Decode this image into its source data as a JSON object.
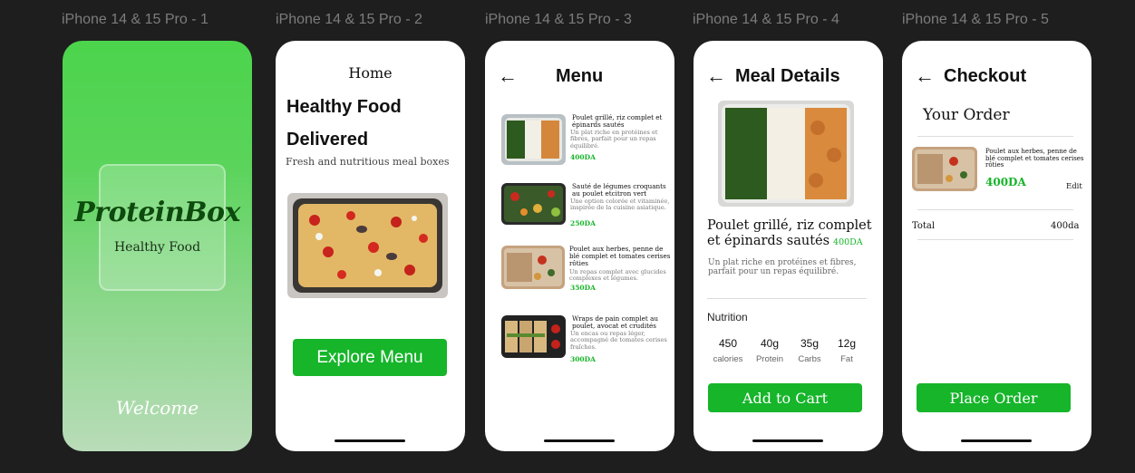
{
  "frames": [
    {
      "label": "iPhone 14 & 15 Pro - 1"
    },
    {
      "label": "iPhone 14 & 15 Pro - 2"
    },
    {
      "label": "iPhone 14 & 15 Pro - 3"
    },
    {
      "label": "iPhone 14 & 15 Pro - 4"
    },
    {
      "label": "iPhone 14 & 15 Pro - 5"
    }
  ],
  "splash": {
    "brand": "ProteinBox",
    "tagline": "Healthy Food",
    "welcome": "Welcome"
  },
  "home": {
    "title": "Home",
    "headline_1": "Healthy Food",
    "headline_2": "Delivered",
    "subtitle": "Fresh and nutritious meal boxes",
    "cta": "Explore Menu"
  },
  "menu": {
    "title": "Menu",
    "items": [
      {
        "name": "Poulet grillé, riz complet et épinards sautés",
        "desc": "Un plat riche en protéines et fibres, parfait pour un repas équilibré.",
        "price": "400DA"
      },
      {
        "name": "Sauté de légumes croquants au poulet etcitron vert",
        "desc": "Une option colorée et vitaminée, inspirée de la cuisine asiatique.",
        "price": "250DA"
      },
      {
        "name": "Poulet aux herbes, penne de blé complet et tomates cerises rôties",
        "desc": "Un repas complet avec glucides complexes et légumes.",
        "price": "350DA"
      },
      {
        "name": "Wraps de pain complet au poulet, avocat et crudités",
        "desc": "Un encas ou repas léger, accompagné de tomates cerises fraîches.",
        "price": "300DA"
      }
    ]
  },
  "details": {
    "title": "Meal Details",
    "name": "Poulet grillé, riz complet et épinards sautés",
    "price": "400DA",
    "desc": "Un plat riche en protéines et fibres, parfait pour un repas équilibré.",
    "nutrition_title": "Nutrition",
    "nutrition": [
      {
        "value": "450",
        "label": "calories"
      },
      {
        "value": "40g",
        "label": "Protein"
      },
      {
        "value": "35g",
        "label": "Carbs"
      },
      {
        "value": "12g",
        "label": "Fat"
      }
    ],
    "cta": "Add to Cart"
  },
  "checkout": {
    "title": "Checkout",
    "your_order": "Your Order",
    "item_name": "Poulet aux herbes, penne de blé complet et tomates cerises rôties",
    "item_price": "400DA",
    "edit": "Edit",
    "total_label": "Total",
    "total_value": "400da",
    "cta": "Place Order"
  },
  "icons": {
    "back": "arrow-left-icon"
  },
  "colors": {
    "accent": "#16b52a",
    "background": "#1e1e1e",
    "splash_top": "#4cd44c",
    "splash_bottom": "#b9dcb9"
  }
}
